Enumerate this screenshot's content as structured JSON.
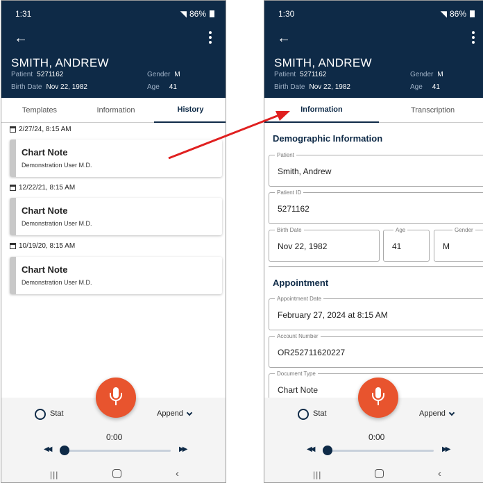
{
  "colors": {
    "header": "#0e2a47",
    "accent": "#e8542e",
    "arrow": "#e02020"
  },
  "left": {
    "status": {
      "time": "1:31",
      "battery": "86%"
    },
    "patient": {
      "name": "SMITH, ANDREW",
      "patient_label": "Patient",
      "patient_id": "5271162",
      "birth_label": "Birth Date",
      "birth_date": "Nov 22, 1982",
      "gender_label": "Gender",
      "gender": "M",
      "age_label": "Age",
      "age": "41"
    },
    "tabs": [
      "Templates",
      "Information",
      "History"
    ],
    "active_tab": "History",
    "history": [
      {
        "date": "2/27/24, 8:15 AM",
        "title": "Chart Note",
        "author": "Demonstration User M.D."
      },
      {
        "date": "12/22/21, 8:15 AM",
        "title": "Chart Note",
        "author": "Demonstration User M.D."
      },
      {
        "date": "10/19/20, 8:15 AM",
        "title": "Chart Note",
        "author": "Demonstration User M.D."
      }
    ],
    "controls": {
      "stat": "Stat",
      "append": "Append",
      "timer": "0:00",
      "progress": 0
    }
  },
  "right": {
    "status": {
      "time": "1:30",
      "battery": "86%"
    },
    "patient": {
      "name": "SMITH, ANDREW",
      "patient_label": "Patient",
      "patient_id": "5271162",
      "birth_label": "Birth Date",
      "birth_date": "Nov 22, 1982",
      "gender_label": "Gender",
      "gender": "M",
      "age_label": "Age",
      "age": "41"
    },
    "tabs": [
      "Information",
      "Transcription"
    ],
    "active_tab": "Information",
    "demographic": {
      "title": "Demographic Information",
      "patient_label": "Patient",
      "patient_value": "Smith, Andrew",
      "patient_id_label": "Patient ID",
      "patient_id_value": "5271162",
      "birth_date_label": "Birth Date",
      "birth_date_value": "Nov 22, 1982",
      "age_label": "Age",
      "age_value": "41",
      "gender_label": "Gender",
      "gender_value": "M"
    },
    "appointment": {
      "title": "Appointment",
      "date_label": "Appointment Date",
      "date_value": "February 27, 2024 at 8:15 AM",
      "account_label": "Account Number",
      "account_value": "OR252711620227",
      "doctype_label": "Document Type",
      "doctype_value": "Chart Note"
    },
    "controls": {
      "stat": "Stat",
      "append": "Append",
      "timer": "0:00",
      "progress": 0
    }
  }
}
